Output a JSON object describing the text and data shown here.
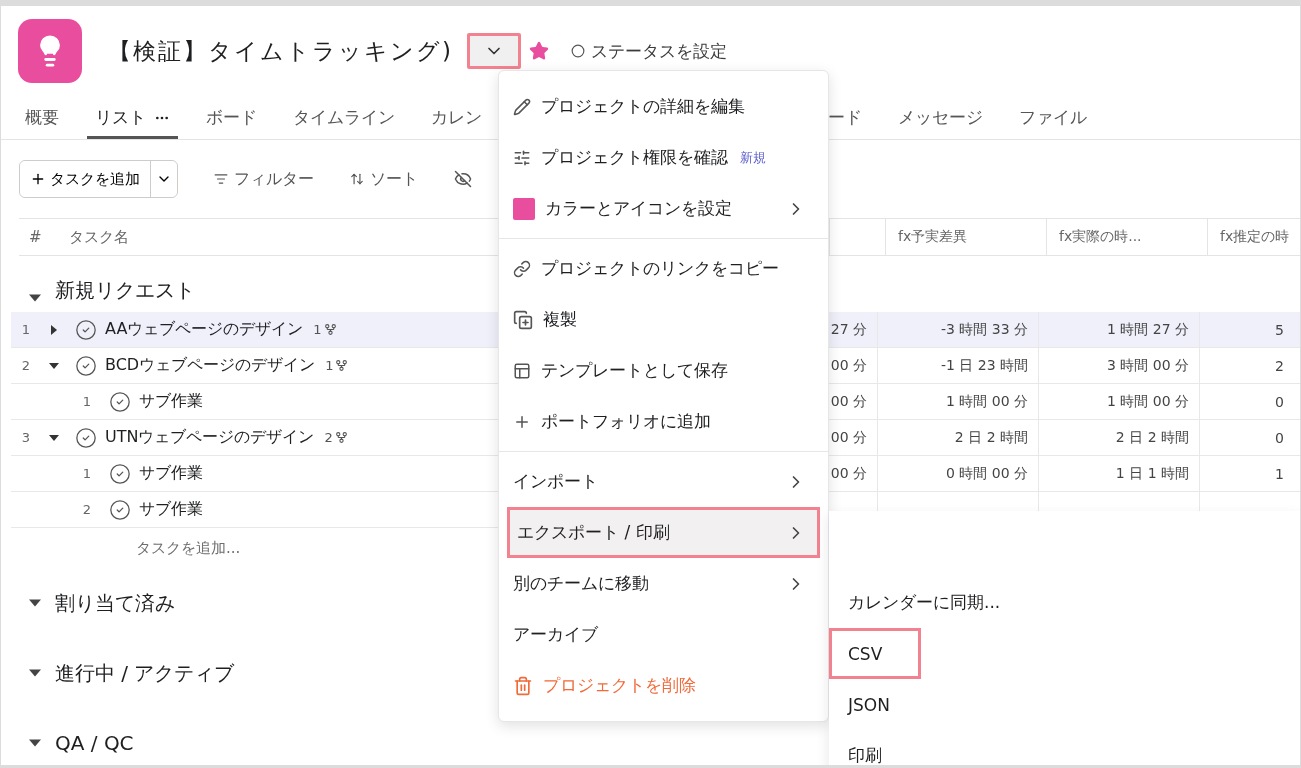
{
  "project": {
    "title": "【検証】タイムトラッキング)",
    "starred": true,
    "status": "ステータスを設定",
    "menu_button": {
      "highlighted": true
    }
  },
  "tabs": [
    {
      "label": "概要",
      "selected": false
    },
    {
      "label": "リスト",
      "selected": true
    },
    {
      "label": "ボード",
      "selected": false
    },
    {
      "label": "タイムライン",
      "selected": false
    },
    {
      "label": "カレン",
      "selected": false
    },
    {
      "label": "ード",
      "selected": false
    },
    {
      "label": "メッセージ",
      "selected": false
    },
    {
      "label": "ファイル",
      "selected": false
    }
  ],
  "toolbar": {
    "add_task": "タスクを追加",
    "filter": "フィルター",
    "sort": "ソート"
  },
  "table": {
    "columns": [
      "#",
      "タスク名"
    ],
    "column_headers": [
      "fx予実差異",
      "fx実際の時...",
      "fx推定の時"
    ],
    "sections": [
      {
        "name": "新規リクエスト",
        "expanded": true,
        "add_task": "タスクを追加...",
        "tasks": [
          {
            "number": "1",
            "name": "AAウェブページのデザイン",
            "subtask_count": "1",
            "expanded": false,
            "selected": true,
            "cells": [
              "27 分",
              "-3 時間 33 分",
              "1 時間 27 分",
              "5"
            ]
          },
          {
            "number": "2",
            "name": "BCDウェブページのデザイン",
            "subtask_count": "1",
            "expanded": true,
            "selected": false,
            "cells": [
              "00 分",
              "-1 日 23 時間",
              "3 時間 00 分",
              "2"
            ],
            "children": [
              {
                "number": "1",
                "name": "サブ作業",
                "selected": false,
                "cells": [
                  "00 分",
                  "1 時間 00 分",
                  "1 時間 00 分",
                  "0"
                ]
              }
            ]
          },
          {
            "number": "3",
            "name": "UTNウェブページのデザイン",
            "subtask_count": "2",
            "expanded": true,
            "selected": false,
            "cells": [
              "00 分",
              "2 日 2 時間",
              "2 日 2 時間",
              "0"
            ],
            "children": [
              {
                "number": "1",
                "name": "サブ作業",
                "selected": false,
                "cells": [
                  "00 分",
                  "0 時間 00 分",
                  "1 日 1 時間",
                  "1"
                ]
              },
              {
                "number": "2",
                "name": "サブ作業",
                "selected": false
              }
            ]
          }
        ]
      },
      {
        "name": "割り当て済み",
        "expanded": true
      },
      {
        "name": "進行中 / アクティブ",
        "expanded": true
      },
      {
        "name": "QA / QC",
        "expanded": true
      }
    ]
  },
  "menu": {
    "groups": [
      [
        {
          "label": "プロジェクトの詳細を編集",
          "kind": "action",
          "selected": false
        },
        {
          "label": "プロジェクト権限を確認",
          "kind": "action",
          "badge": "新規",
          "selected": false
        },
        {
          "label": "カラーとアイコンを設定",
          "kind": "submenu",
          "selected": false
        }
      ],
      [
        {
          "label": "プロジェクトのリンクをコピー",
          "kind": "action",
          "selected": false
        },
        {
          "label": "複製",
          "kind": "action",
          "selected": false
        },
        {
          "label": "テンプレートとして保存",
          "kind": "action",
          "selected": false
        },
        {
          "label": "ポートフォリオに追加",
          "kind": "action",
          "selected": false
        }
      ],
      [
        {
          "label": "インポート",
          "kind": "submenu",
          "selected": false
        },
        {
          "label": "エクスポート / 印刷",
          "kind": "submenu",
          "selected": true,
          "highlighted": true
        },
        {
          "label": "別のチームに移動",
          "kind": "submenu",
          "selected": false
        },
        {
          "label": "アーカイブ",
          "kind": "action",
          "selected": false
        },
        {
          "label": "プロジェクトを削除",
          "kind": "danger",
          "selected": false
        }
      ]
    ]
  },
  "submenu": {
    "items": [
      {
        "label": "カレンダーに同期...",
        "highlighted": false
      },
      {
        "label": "CSV",
        "highlighted": true
      },
      {
        "label": "JSON",
        "highlighted": false
      },
      {
        "label": "印刷",
        "highlighted": false
      }
    ]
  }
}
